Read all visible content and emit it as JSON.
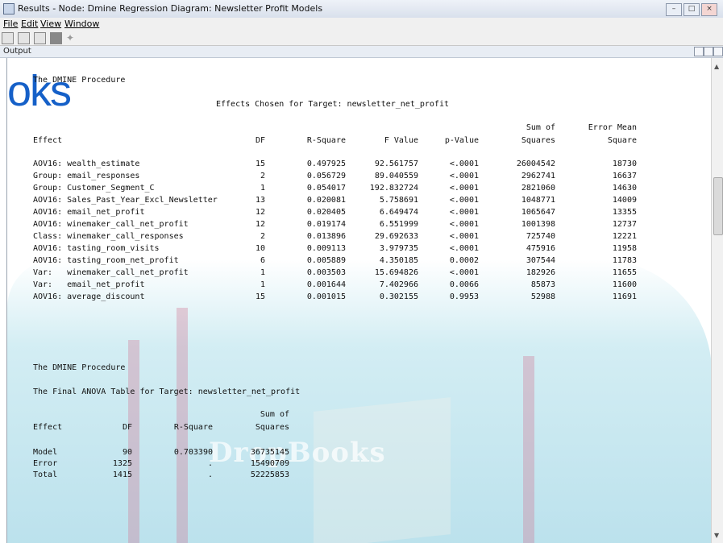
{
  "window": {
    "title": "Results - Node: Dmine Regression Diagram: Newsletter Profit Models"
  },
  "menu": {
    "file": "File",
    "edit": "Edit",
    "view": "View",
    "window": "Window"
  },
  "output_panel": {
    "label": "Output"
  },
  "watermark": {
    "brand_partial": "oks",
    "brand_center": "DropBooks"
  },
  "report1": {
    "header": "The DMINE Procedure",
    "title": "Effects Chosen for Target: newsletter_net_profit",
    "col_effect": "Effect",
    "col_df": "DF",
    "col_rsq": "R-Square",
    "col_f": "F Value",
    "col_p": "p-Value",
    "col_ss_1": "Sum of",
    "col_ss_2": "Squares",
    "col_ems_1": "Error Mean",
    "col_ems_2": "Square",
    "rows": [
      {
        "effect": "AOV16: wealth_estimate",
        "df": "15",
        "rsq": "0.497925",
        "f": "92.561757",
        "p": "<.0001",
        "ss": "26004542",
        "ems": "18730"
      },
      {
        "effect": "Group: email_responses",
        "df": "2",
        "rsq": "0.056729",
        "f": "89.040559",
        "p": "<.0001",
        "ss": "2962741",
        "ems": "16637"
      },
      {
        "effect": "Group: Customer_Segment_C",
        "df": "1",
        "rsq": "0.054017",
        "f": "192.832724",
        "p": "<.0001",
        "ss": "2821060",
        "ems": "14630"
      },
      {
        "effect": "AOV16: Sales_Past_Year_Excl_Newsletter",
        "df": "13",
        "rsq": "0.020081",
        "f": "5.758691",
        "p": "<.0001",
        "ss": "1048771",
        "ems": "14009"
      },
      {
        "effect": "AOV16: email_net_profit",
        "df": "12",
        "rsq": "0.020405",
        "f": "6.649474",
        "p": "<.0001",
        "ss": "1065647",
        "ems": "13355"
      },
      {
        "effect": "AOV16: winemaker_call_net_profit",
        "df": "12",
        "rsq": "0.019174",
        "f": "6.551999",
        "p": "<.0001",
        "ss": "1001398",
        "ems": "12737"
      },
      {
        "effect": "Class: winemaker_call_responses",
        "df": "2",
        "rsq": "0.013896",
        "f": "29.692633",
        "p": "<.0001",
        "ss": "725740",
        "ems": "12221"
      },
      {
        "effect": "AOV16: tasting_room_visits",
        "df": "10",
        "rsq": "0.009113",
        "f": "3.979735",
        "p": "<.0001",
        "ss": "475916",
        "ems": "11958"
      },
      {
        "effect": "AOV16: tasting_room_net_profit",
        "df": "6",
        "rsq": "0.005889",
        "f": "4.350185",
        "p": "0.0002",
        "ss": "307544",
        "ems": "11783"
      },
      {
        "effect": "Var:   winemaker_call_net_profit",
        "df": "1",
        "rsq": "0.003503",
        "f": "15.694826",
        "p": "<.0001",
        "ss": "182926",
        "ems": "11655"
      },
      {
        "effect": "Var:   email_net_profit",
        "df": "1",
        "rsq": "0.001644",
        "f": "7.402966",
        "p": "0.0066",
        "ss": "85873",
        "ems": "11600"
      },
      {
        "effect": "AOV16: average_discount",
        "df": "15",
        "rsq": "0.001015",
        "f": "0.302155",
        "p": "0.9953",
        "ss": "52988",
        "ems": "11691"
      }
    ]
  },
  "report2": {
    "header": "The DMINE Procedure",
    "title": "The Final ANOVA Table for Target: newsletter_net_profit",
    "col_effect": "Effect",
    "col_df": "DF",
    "col_rsq": "R-Square",
    "col_ss_1": "Sum of",
    "col_ss_2": "Squares",
    "rows": [
      {
        "effect": "Model",
        "df": "90",
        "rsq": "0.703390",
        "ss": "36735145"
      },
      {
        "effect": "Error",
        "df": "1325",
        "rsq": ".",
        "ss": "15490709"
      },
      {
        "effect": "Total",
        "df": "1415",
        "rsq": ".",
        "ss": "52225853"
      }
    ]
  }
}
